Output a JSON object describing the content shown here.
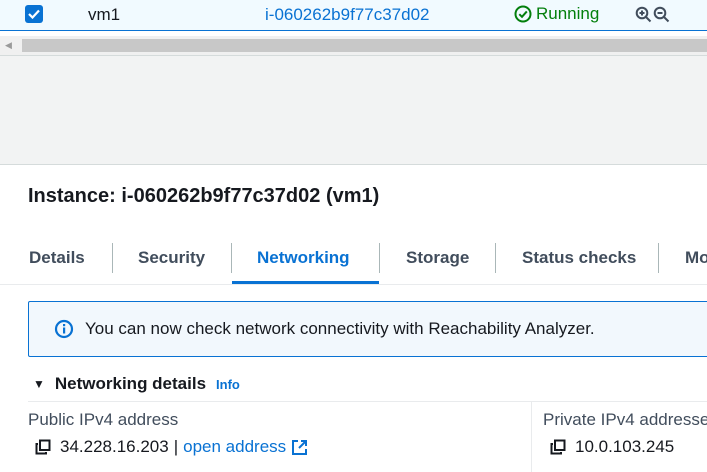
{
  "instance_row": {
    "name": "vm1",
    "instance_id": "i-060262b9f77c37d02",
    "state": "Running",
    "selected": true,
    "icons": [
      "checkbox-checked-icon",
      "status-check-icon",
      "zoom-in-icon",
      "zoom-out-icon"
    ]
  },
  "details_panel": {
    "title": "Instance: i-060262b9f77c37d02 (vm1)",
    "tabs": [
      {
        "label": "Details"
      },
      {
        "label": "Security"
      },
      {
        "label": "Networking"
      },
      {
        "label": "Storage"
      },
      {
        "label": "Status checks"
      },
      {
        "label": "Mo"
      }
    ],
    "active_tab": "Networking",
    "banner": {
      "message": "You can now check network connectivity with Reachability Analyzer.",
      "icon": "info-circle-icon"
    },
    "networking_details": {
      "title": "Networking details",
      "info_label": "Info",
      "public_ipv4_label": "Public IPv4 address",
      "public_ipv4_value": "34.228.16.203",
      "separator": "|",
      "open_address_label": "open address",
      "private_ipv4_label": "Private IPv4 addresse",
      "private_ipv4_value": "10.0.103.245"
    }
  },
  "colors": {
    "accent": "#0972d3",
    "success": "#037f0c",
    "text": "#16191f",
    "muted": "#414d5c"
  }
}
